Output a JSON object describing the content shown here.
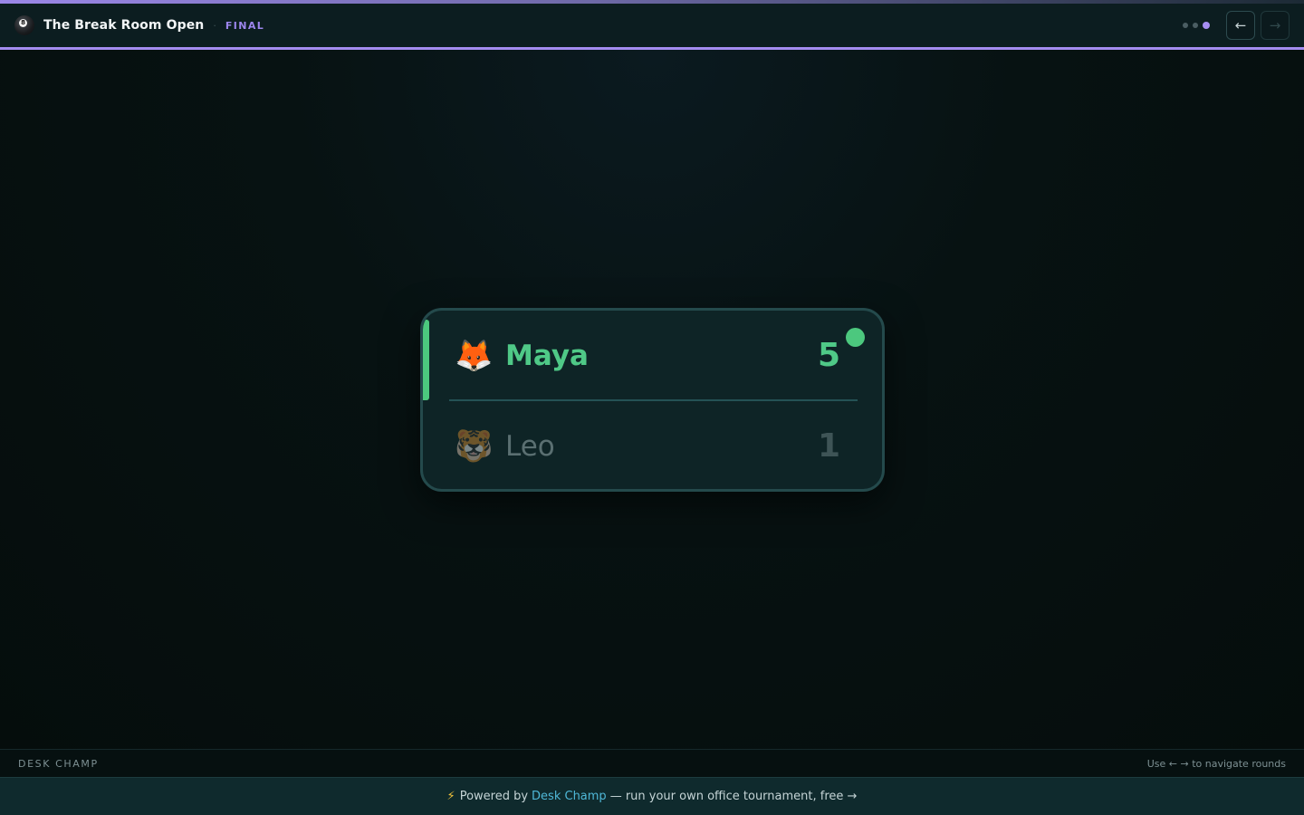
{
  "header": {
    "logo_icon": "8-ball-icon",
    "logo_glyph": "8",
    "title": "The Break Room Open",
    "round_label": "FINAL",
    "round_dots": {
      "total": 3,
      "active_index": 2
    },
    "prev_glyph": "←",
    "next_glyph": "→",
    "next_disabled": true
  },
  "match": {
    "players": [
      {
        "emoji": "🦊",
        "name": "Maya",
        "score": "5",
        "winner": true
      },
      {
        "emoji": "🐯",
        "name": "Leo",
        "score": "1",
        "winner": false
      }
    ]
  },
  "footer": {
    "brand": "DESK CHAMP",
    "hint": "Use ← → to navigate rounds"
  },
  "promo": {
    "bolt": "⚡",
    "prefix": "Powered by",
    "link": "Desk Champ",
    "suffix": "— run your own office tournament, free →"
  },
  "colors": {
    "accent": "#a48cf0",
    "winner": "#4cc87e",
    "link": "#4fb8d8"
  }
}
